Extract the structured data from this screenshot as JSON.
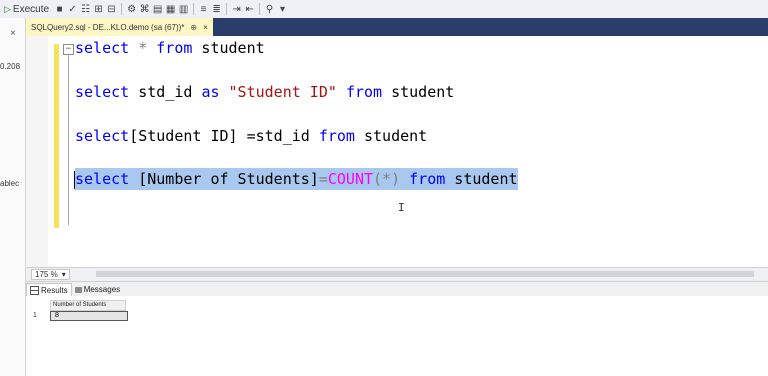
{
  "toolbar": {
    "execute_label": "Execute"
  },
  "left_pane": {
    "close_glyph": "×",
    "items": [
      {
        "label": "0.208",
        "top_hint": "upper"
      },
      {
        "label": "ablec",
        "top_hint": "lower"
      }
    ]
  },
  "tab": {
    "label": "SQLQuery2.sql - DE...KLO.demo (sa (67))*",
    "pin_glyph": "⊕",
    "close_glyph": "×"
  },
  "editor": {
    "lines": [
      {
        "id": "l1",
        "tokens": [
          [
            "select",
            "kw"
          ],
          [
            " * ",
            "op"
          ],
          [
            "from",
            "kw"
          ],
          [
            " student",
            ""
          ]
        ]
      },
      {
        "id": "l2",
        "tokens": [
          [
            "select",
            "kw"
          ],
          [
            " std_id ",
            ""
          ],
          [
            "as",
            "kw"
          ],
          [
            " ",
            ""
          ],
          [
            "\"Student ID\"",
            "str"
          ],
          [
            " ",
            ""
          ],
          [
            "from",
            "kw"
          ],
          [
            " student",
            ""
          ]
        ]
      },
      {
        "id": "l3",
        "tokens": [
          [
            "select",
            "kw"
          ],
          [
            "[Student ID] =std_id ",
            ""
          ],
          [
            "from",
            "kw"
          ],
          [
            " student",
            ""
          ]
        ]
      },
      {
        "id": "l4",
        "tokens": [
          [
            "select",
            "kw"
          ],
          [
            " [Number of Students]",
            ""
          ],
          [
            "=",
            "op"
          ],
          [
            "COUNT",
            "fn"
          ],
          [
            "(*)",
            "op"
          ],
          [
            " ",
            ""
          ],
          [
            "from",
            "kw"
          ],
          [
            " student",
            ""
          ]
        ]
      }
    ],
    "selected_line": "l4",
    "collapse_glyph": "−"
  },
  "status": {
    "zoom": "175 %",
    "zoom_arrow": "▾"
  },
  "results_tabs": {
    "results": "Results",
    "messages": "Messages"
  },
  "results": {
    "columns": [
      "Number of Students"
    ],
    "rows": [
      {
        "num": "1",
        "values": [
          "8"
        ]
      }
    ]
  }
}
